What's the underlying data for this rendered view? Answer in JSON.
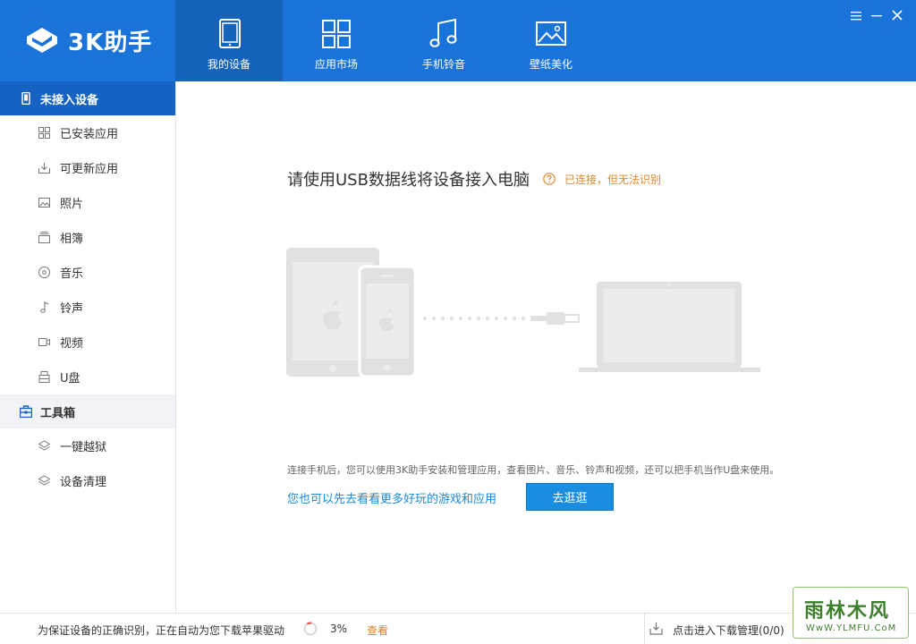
{
  "app": {
    "name": "3K助手"
  },
  "nav": [
    {
      "label": "我的设备",
      "icon": "tablet-icon",
      "active": true
    },
    {
      "label": "应用市场",
      "icon": "grid-icon",
      "active": false
    },
    {
      "label": "手机铃音",
      "icon": "music-note-icon",
      "active": false
    },
    {
      "label": "壁纸美化",
      "icon": "picture-icon",
      "active": false
    }
  ],
  "sidebar": {
    "device_section": "未接入设备",
    "device_items": [
      {
        "label": "已安装应用",
        "icon": "apps-grid-icon"
      },
      {
        "label": "可更新应用",
        "icon": "download-icon"
      },
      {
        "label": "照片",
        "icon": "photo-icon"
      },
      {
        "label": "相簿",
        "icon": "album-icon"
      },
      {
        "label": "音乐",
        "icon": "music-disc-icon"
      },
      {
        "label": "铃声",
        "icon": "bell-note-icon"
      },
      {
        "label": "视频",
        "icon": "video-icon"
      },
      {
        "label": "U盘",
        "icon": "usb-drive-icon"
      }
    ],
    "tools_section": "工具箱",
    "tools_items": [
      {
        "label": "一键越狱",
        "icon": "layers-icon"
      },
      {
        "label": "设备清理",
        "icon": "layers-icon"
      }
    ]
  },
  "main": {
    "headline": "请使用USB数据线将设备接入电脑",
    "status": "已连接，但无法识别",
    "description": "连接手机后，您可以使用3K助手安装和管理应用，查看图片、音乐、铃声和视频，还可以把手机当作U盘来使用。",
    "promo_link": "您也可以先去看看更多好玩的游戏和应用",
    "go_button": "去逛逛"
  },
  "statusbar": {
    "message": "为保证设备的正确识别，正在自动为您下载苹果驱动",
    "progress_percent": "3%",
    "progress_value": 3,
    "view_link": "查看",
    "download_manager": "点击进入下载管理(0/0)"
  },
  "watermark": {
    "top_text": "雨林木风",
    "bottom_text": "WwW.YLMFU.CoM"
  },
  "colors": {
    "topbar": "#1a73d8",
    "nav_active": "#1663bd",
    "sidebar_active": "#1763c4",
    "status_orange": "#e0892d",
    "link_blue": "#1a8ad6",
    "button_blue": "#1b8de0",
    "illustration_gray": "#e1e1e1"
  }
}
